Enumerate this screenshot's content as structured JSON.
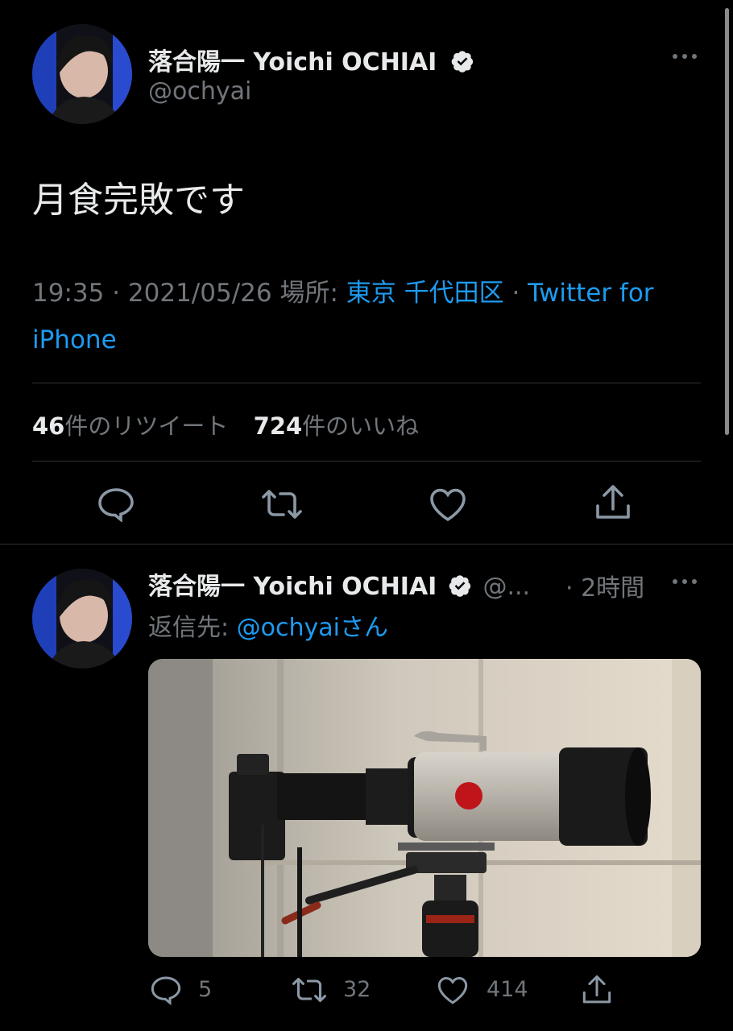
{
  "tweet": {
    "author_name": "落合陽一 Yoichi OCHIAI",
    "author_handle": "@ochyai",
    "text": "月食完敗です",
    "time": "19:35",
    "sep1": " · ",
    "date": "2021/05/26",
    "location_label": " 場所: ",
    "location": "東京 千代田区",
    "sep2": " · ",
    "source_line1": "Twitter for",
    "source_line2": "iPhone",
    "retweet_count": "46",
    "retweet_label": "件のリツイート",
    "like_count": "724",
    "like_label": "件のいいね"
  },
  "reply": {
    "author_name": "落合陽一 Yoichi OCHIAI",
    "author_handle": "@...",
    "time_ago": "· 2時間",
    "reply_to_label": "返信先: ",
    "reply_to_handle": "@ochyaiさん",
    "reply_count": "5",
    "retweet_count": "32",
    "like_count": "414"
  },
  "colors": {
    "accent": "#1d9bf0",
    "muted": "#71767b",
    "text": "#e7e9ea",
    "background": "#000000"
  }
}
